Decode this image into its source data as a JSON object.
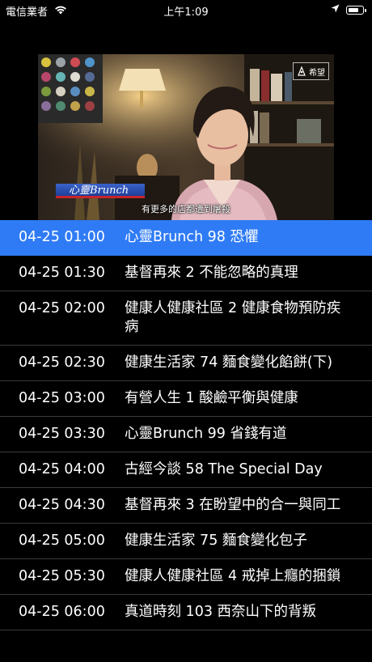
{
  "status_bar": {
    "carrier": "電信業者",
    "time": "上午1:09",
    "battery_level": 0.75,
    "icons": [
      "wifi-icon",
      "location-arrow-icon",
      "battery-icon"
    ]
  },
  "video": {
    "show_banner": "心靈Brunch",
    "subtitle": "有更多的店都遭到屠殺",
    "channel_logo": "希望"
  },
  "schedule": [
    {
      "time": "04-25 01:00",
      "title": "心靈Brunch 98 恐懼",
      "active": true
    },
    {
      "time": "04-25 01:30",
      "title": "基督再來 2 不能忽略的真理",
      "active": false
    },
    {
      "time": "04-25 02:00",
      "title": "健康人健康社區 2 健康食物預防疾病",
      "active": false
    },
    {
      "time": "04-25 02:30",
      "title": "健康生活家 74 麵食變化餡餅(下)",
      "active": false
    },
    {
      "time": "04-25 03:00",
      "title": "有營人生 1 酸鹼平衡與健康",
      "active": false
    },
    {
      "time": "04-25 03:30",
      "title": "心靈Brunch 99 省錢有道",
      "active": false
    },
    {
      "time": "04-25 04:00",
      "title": "古經今談 58 The Special Day",
      "active": false
    },
    {
      "time": "04-25 04:30",
      "title": "基督再來 3 在盼望中的合一與同工",
      "active": false
    },
    {
      "time": "04-25 05:00",
      "title": "健康生活家 75 麵食變化包子",
      "active": false
    },
    {
      "time": "04-25 05:30",
      "title": "健康人健康社區 4 戒掉上癮的捆鎖",
      "active": false
    },
    {
      "time": "04-25 06:00",
      "title": "真道時刻 103 西奈山下的背叛",
      "active": false
    }
  ],
  "colors": {
    "background": "#000000",
    "active_row": "#2f7bf5",
    "divider": "#3a3a3a",
    "text": "#ffffff"
  }
}
